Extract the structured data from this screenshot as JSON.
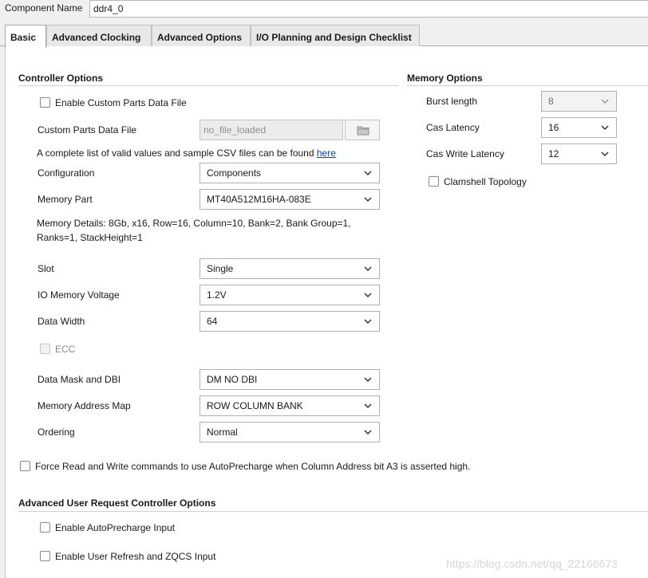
{
  "header": {
    "component_name_label": "Component Name",
    "component_name_value": "ddr4_0"
  },
  "tabs": [
    {
      "label": "Basic",
      "active": true
    },
    {
      "label": "Advanced Clocking",
      "active": false
    },
    {
      "label": "Advanced Options",
      "active": false
    },
    {
      "label": "I/O Planning and Design Checklist",
      "active": false
    }
  ],
  "controller_options": {
    "title": "Controller Options",
    "enable_custom_parts": {
      "label": "Enable Custom Parts Data File",
      "checked": false
    },
    "custom_parts_file": {
      "label": "Custom Parts Data File",
      "value": "no_file_loaded"
    },
    "csv_note": "A complete list of valid values and sample CSV files can be found",
    "csv_link": "here",
    "configuration": {
      "label": "Configuration",
      "value": "Components"
    },
    "memory_part": {
      "label": "Memory Part",
      "value": "MT40A512M16HA-083E"
    },
    "memory_details_line1": "Memory Details: 8Gb, x16, Row=16, Column=10, Bank=2, Bank Group=1,",
    "memory_details_line2": "Ranks=1, StackHeight=1",
    "slot": {
      "label": "Slot",
      "value": "Single"
    },
    "io_voltage": {
      "label": "IO Memory Voltage",
      "value": "1.2V"
    },
    "data_width": {
      "label": "Data Width",
      "value": "64"
    },
    "ecc": {
      "label": "ECC",
      "checked": false,
      "enabled": false
    },
    "data_mask": {
      "label": "Data Mask and DBI",
      "value": "DM NO DBI"
    },
    "address_map": {
      "label": "Memory Address Map",
      "value": "ROW COLUMN BANK"
    },
    "ordering": {
      "label": "Ordering",
      "value": "Normal"
    },
    "force_autoprecharge": {
      "label": "Force Read and Write commands to use AutoPrecharge when Column Address bit A3 is asserted high.",
      "checked": false
    }
  },
  "memory_options": {
    "title": "Memory Options",
    "burst_length": {
      "label": "Burst length",
      "value": "8"
    },
    "cas_latency": {
      "label": "Cas Latency",
      "value": "16"
    },
    "cas_write_latency": {
      "label": "Cas Write Latency",
      "value": "12"
    },
    "clamshell": {
      "label": "Clamshell Topology",
      "checked": false
    }
  },
  "advanced_user_request": {
    "title": "Advanced User Request Controller Options",
    "autoprecharge_input": {
      "label": "Enable AutoPrecharge Input",
      "checked": false
    },
    "user_refresh": {
      "label": "Enable User Refresh and ZQCS Input",
      "checked": false
    }
  },
  "watermark": "https://blog.csdn.net/qq_22166673",
  "colors": {
    "link": "#0b3bd6",
    "panel_bg": "#ffffff",
    "window_bg": "#f0f0f0"
  },
  "icons": [
    "folder-icon",
    "chevron-down-icon"
  ]
}
